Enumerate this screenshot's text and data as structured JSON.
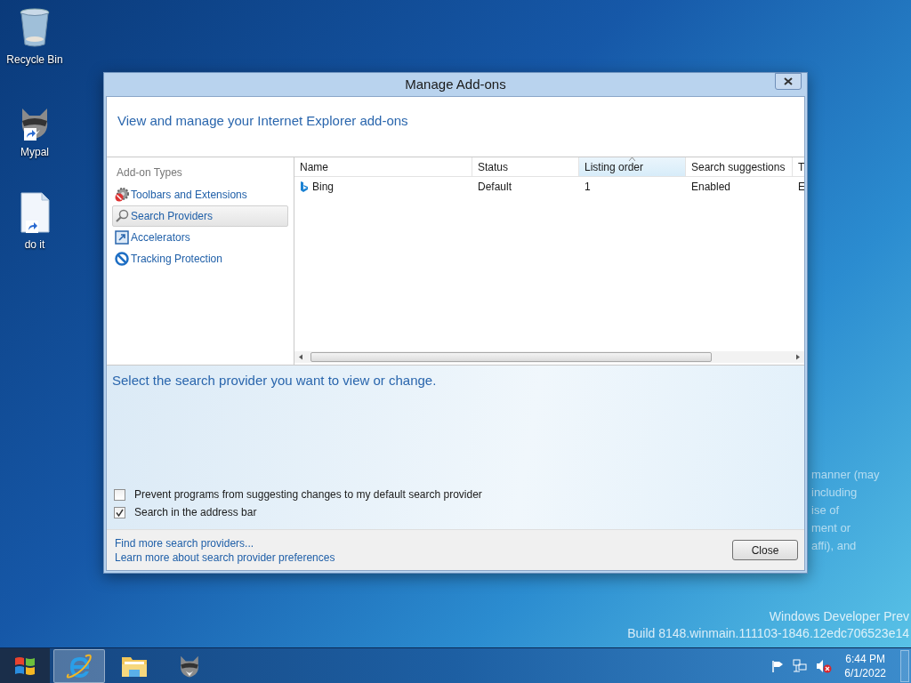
{
  "desktop_icons": [
    {
      "label": "Recycle Bin",
      "kind": "recycle"
    },
    {
      "label": "Mypal",
      "kind": "raccoon"
    },
    {
      "label": "do it",
      "kind": "document"
    }
  ],
  "window": {
    "title": "Manage Add-ons"
  },
  "header": "View and manage your Internet Explorer add-ons",
  "addon_types": {
    "heading": "Add-on Types",
    "items": [
      {
        "label": "Toolbars and Extensions",
        "kind": "gear",
        "selected": false
      },
      {
        "label": "Search Providers",
        "kind": "search",
        "selected": true
      },
      {
        "label": "Accelerators",
        "kind": "accelerator",
        "selected": false
      },
      {
        "label": "Tracking Protection",
        "kind": "block",
        "selected": false
      }
    ]
  },
  "table": {
    "columns": [
      {
        "label": "Name",
        "sorted": false
      },
      {
        "label": "Status",
        "sorted": false
      },
      {
        "label": "Listing order",
        "sorted": true
      },
      {
        "label": "Search suggestions",
        "sorted": false
      },
      {
        "label": "T",
        "sorted": false
      }
    ],
    "rows": [
      {
        "cells": [
          "Bing",
          "Default",
          "1",
          "Enabled",
          "E"
        ]
      }
    ]
  },
  "details": {
    "prompt": "Select the search provider you want to view or change.",
    "options": [
      {
        "label": "Prevent programs from suggesting changes to my default search provider",
        "checked": false
      },
      {
        "label": "Search in the address bar",
        "checked": true
      }
    ]
  },
  "links": [
    "Find more search providers...",
    "Learn more about search provider preferences"
  ],
  "close_button": "Close",
  "faded_text": [
    "manner (may",
    "including",
    "ise of",
    "ment or",
    "affi), and"
  ],
  "watermark": [
    "Windows Developer Prev",
    "Build 8148.winmain.111103-1846.12edc706523e14"
  ],
  "taskbar": {
    "apps": [
      {
        "kind": "ie",
        "selected": true
      },
      {
        "kind": "explorer",
        "selected": false
      },
      {
        "kind": "raccoon",
        "selected": false
      }
    ],
    "tray": [
      {
        "kind": "flag"
      },
      {
        "kind": "network"
      },
      {
        "kind": "volume-muted"
      }
    ],
    "time": "6:44 PM",
    "date": "6/1/2022"
  }
}
